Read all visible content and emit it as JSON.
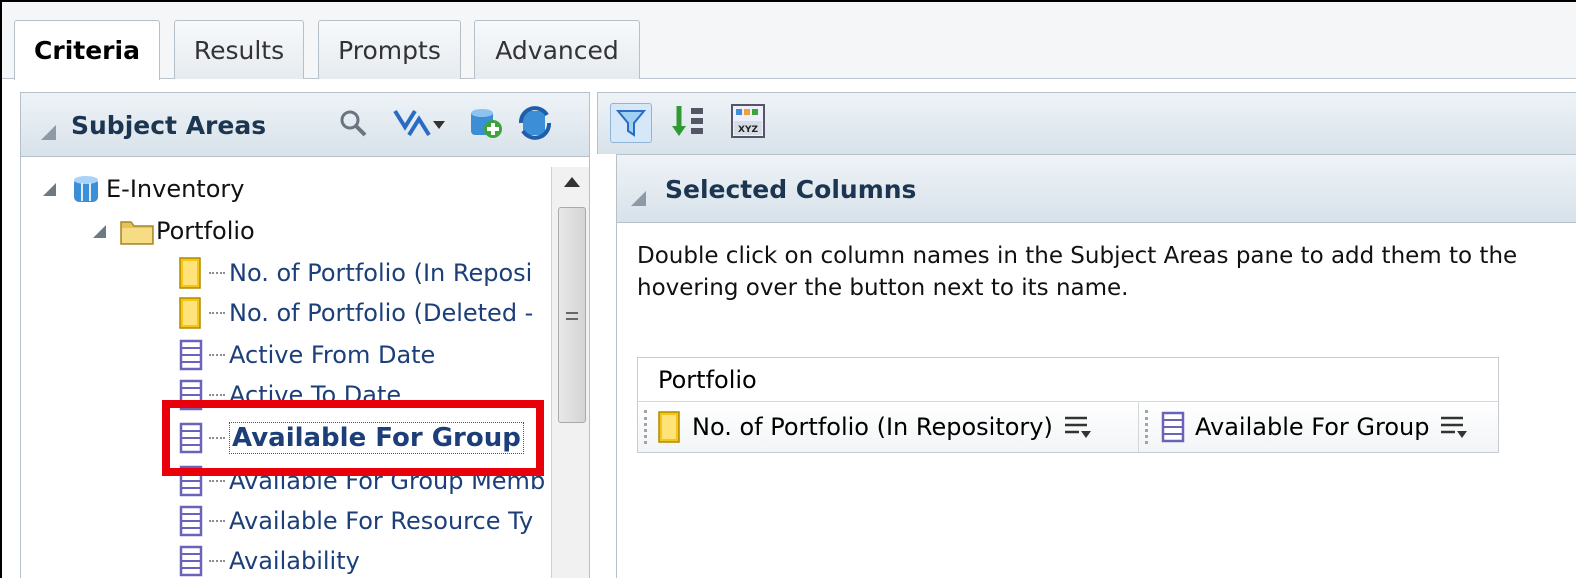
{
  "tabs": [
    {
      "label": "Criteria",
      "active": true
    },
    {
      "label": "Results",
      "active": false
    },
    {
      "label": "Prompts",
      "active": false
    },
    {
      "label": "Advanced",
      "active": false
    }
  ],
  "subject_areas": {
    "title": "Subject Areas",
    "toolbar_icons": [
      "search-icon",
      "sort-icon",
      "add-subject-area-icon",
      "refresh-icon"
    ],
    "tree": {
      "root": "E-Inventory",
      "folder": "Portfolio",
      "columns": [
        {
          "label": "No. of Portfolio (In Reposi",
          "type": "measure"
        },
        {
          "label": "No. of Portfolio (Deleted - ",
          "type": "measure"
        },
        {
          "label": "Active From Date",
          "type": "attribute"
        },
        {
          "label": "Active To Date",
          "type": "attribute"
        },
        {
          "label": "Available For Group",
          "type": "attribute",
          "selected": true
        },
        {
          "label": "Available For Group Memb",
          "type": "attribute"
        },
        {
          "label": "Available For Resource Ty",
          "type": "attribute"
        },
        {
          "label": "Availability",
          "type": "attribute"
        }
      ]
    }
  },
  "criteria_toolbar_icons": [
    "filter-icon",
    "sort-order-icon",
    "column-properties-icon"
  ],
  "selected_columns": {
    "title": "Selected Columns",
    "description_line1": "Double click on column names in the Subject Areas pane to add them to the",
    "description_line2": "hovering over the button next to its name.",
    "group_label": "Portfolio",
    "columns": [
      {
        "label": "No. of Portfolio (In Repository)",
        "type": "measure"
      },
      {
        "label": "Available For Group",
        "type": "attribute"
      }
    ]
  },
  "colors": {
    "highlight": "#e8000b",
    "measure_icon": "#f5c518",
    "attribute_icon": "#6a64b8",
    "header_text": "#1c3550"
  }
}
